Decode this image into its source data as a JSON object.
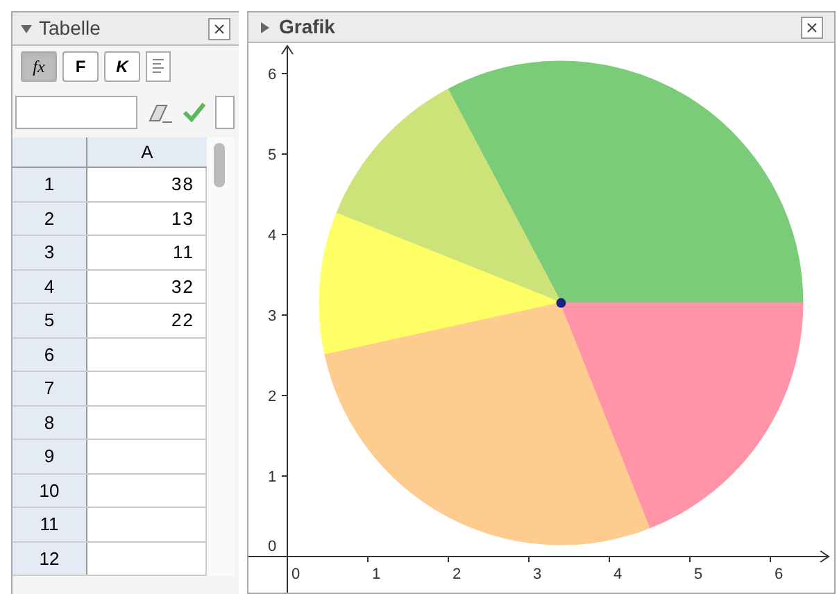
{
  "table": {
    "title": "Tabelle",
    "expanded": true,
    "toolbar": [
      {
        "label": "fx",
        "selected": true
      },
      {
        "label": "F",
        "selected": false
      },
      {
        "label": "K",
        "selected": false
      }
    ],
    "column_header": "A",
    "rows": [
      {
        "number": "1",
        "value": "38"
      },
      {
        "number": "2",
        "value": "13"
      },
      {
        "number": "3",
        "value": "11"
      },
      {
        "number": "4",
        "value": "32"
      },
      {
        "number": "5",
        "value": "22"
      },
      {
        "number": "6"
      },
      {
        "number": "7"
      },
      {
        "number": "8"
      },
      {
        "number": "9"
      },
      {
        "number": "10"
      },
      {
        "number": "11"
      },
      {
        "number": "12"
      }
    ]
  },
  "graphics": {
    "title": "Grafik",
    "expanded": false,
    "slices": [
      {
        "color": "#7acc78"
      },
      {
        "color": "#cde37a"
      },
      {
        "color": "#ffff66"
      },
      {
        "color": "#ffcc8f"
      },
      {
        "color": "#ff94a8"
      }
    ],
    "x_axis_labels": [
      "0",
      "1",
      "2",
      "3",
      "4",
      "5",
      "6"
    ],
    "y_axis_labels": [
      "6",
      "5",
      "4",
      "3",
      "2",
      "1",
      "0"
    ]
  }
}
